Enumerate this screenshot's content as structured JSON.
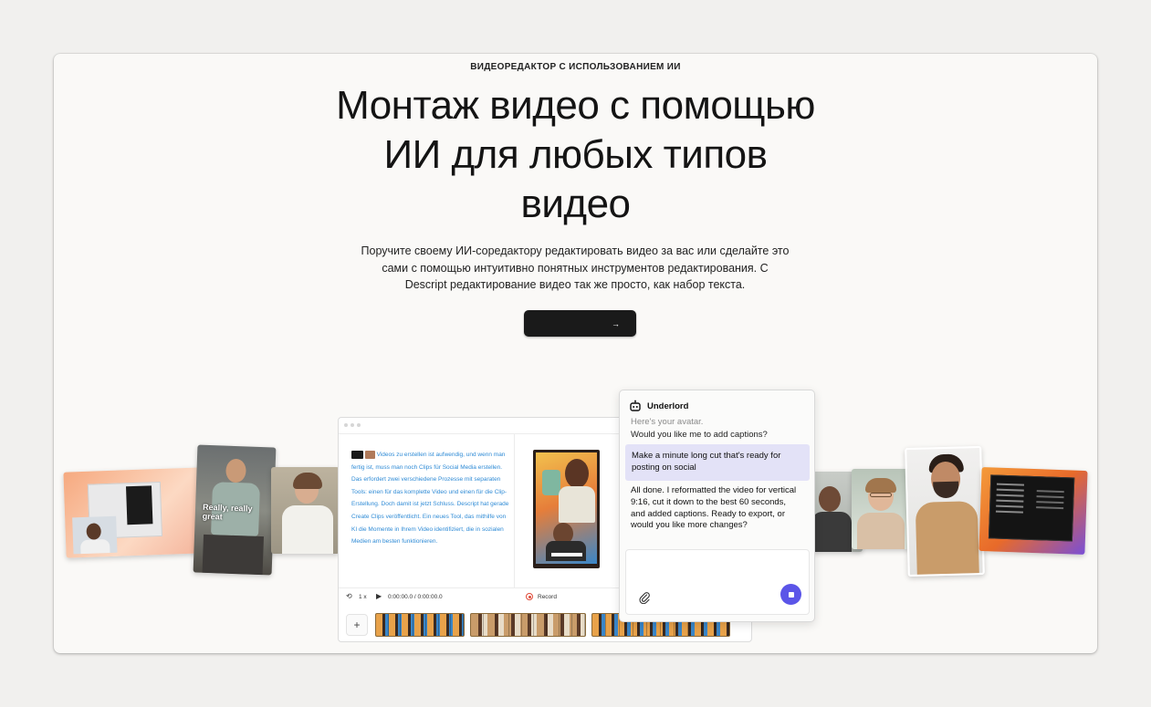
{
  "hero": {
    "eyebrow": "ВИДЕОРЕДАКТОР С ИСПОЛЬЗОВАНИЕМ ИИ",
    "headline": "Монтаж видео с помощью ИИ для любых типов видео",
    "subtext": "Поручите своему ИИ-соредактору редактировать видео за вас или сделайте это сами с помощью интуитивно понятных инструментов редактирования. С Descript редактирование видео так же просто, как набор текста.",
    "cta_label": "",
    "cta_arrow": "→"
  },
  "photos": {
    "left_caption": "Really, really great"
  },
  "editor": {
    "script_text": "Videos zu erstellen ist aufwendig, und wenn man fertig ist, muss man noch Clips für Social Media erstellen. Das erfordert zwei verschiedene Prozesse mit separaten Tools: einen für das komplette Video und einen für die Clip-Erstellung. Doch damit ist jetzt Schluss. Descript hat gerade Create Clips veröffentlicht. Ein neues Tool, das mithilfe von KI die Momente in Ihrem Video identifiziert, die in sozialen Medien am besten funktionieren.",
    "transport": {
      "speed": "1 x",
      "timecode": "0:00:00.0 / 0:00:00.0",
      "record_label": "Record"
    },
    "add_symbol": "+"
  },
  "chat": {
    "assistant_name": "Underlord",
    "faded_line": "Here's your avatar.",
    "question_line": "Would you like me to add captions?",
    "user_message": "Make a minute long cut that's ready for posting on social",
    "reply": "All done. I reformatted the video for vertical 9:16, cut it down to the best 60 seconds, and added captions. Ready to export, or would you like more changes?",
    "input_value": ""
  },
  "colors": {
    "accent": "#5b55e8",
    "bubble": "#e3e2f7",
    "cta_bg": "#1a1a1a",
    "script_text": "#2f8bd6",
    "record": "#e04b3a"
  }
}
